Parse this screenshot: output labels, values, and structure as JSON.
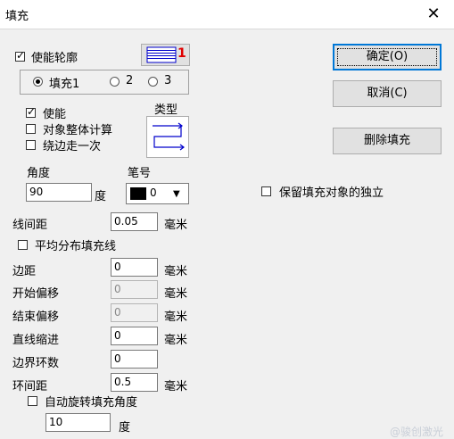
{
  "window": {
    "title": "填充",
    "close_symbol": "✕"
  },
  "outline": {
    "label": "使能轮廓",
    "checked": true,
    "badge": "1"
  },
  "fill_select": {
    "options": [
      {
        "label": "填充1",
        "checked": true
      },
      {
        "label": "2",
        "checked": false
      },
      {
        "label": "3",
        "checked": false
      }
    ]
  },
  "options": {
    "enable": {
      "label": "使能",
      "checked": true
    },
    "whole_calc": {
      "label": "对象整体计算",
      "checked": false
    },
    "edge_once": {
      "label": "绕边走一次",
      "checked": false
    }
  },
  "type": {
    "label": "类型"
  },
  "angle": {
    "label": "角度",
    "value": "90",
    "unit": "度"
  },
  "pen": {
    "label": "笔号",
    "value": "0",
    "color": "#000000"
  },
  "line_spacing": {
    "label": "线间距",
    "value": "0.05",
    "unit": "毫米"
  },
  "avg_distribute": {
    "label": "平均分布填充线",
    "checked": false
  },
  "margin": {
    "label": "边距",
    "value": "0",
    "unit": "毫米"
  },
  "start_offset": {
    "label": "开始偏移",
    "value": "0",
    "unit": "毫米"
  },
  "end_offset": {
    "label": "结束偏移",
    "value": "0",
    "unit": "毫米"
  },
  "line_shrink": {
    "label": "直线缩进",
    "value": "0",
    "unit": "毫米"
  },
  "border_loops": {
    "label": "边界环数",
    "value": "0"
  },
  "loop_spacing": {
    "label": "环间距",
    "value": "0.5",
    "unit": "毫米"
  },
  "auto_rotate": {
    "label": "自动旋转填充角度",
    "checked": false,
    "value": "10",
    "unit": "度"
  },
  "buttons": {
    "ok": "确定(O)",
    "cancel": "取消(C)",
    "delete_fill": "删除填充"
  },
  "keep_independent": {
    "label": "保留填充对象的独立",
    "checked": false
  },
  "watermark": "@骏创激光",
  "colors": {
    "accent": "#0078d7",
    "icon_blue": "#0000cc",
    "badge_red": "#e00000"
  }
}
